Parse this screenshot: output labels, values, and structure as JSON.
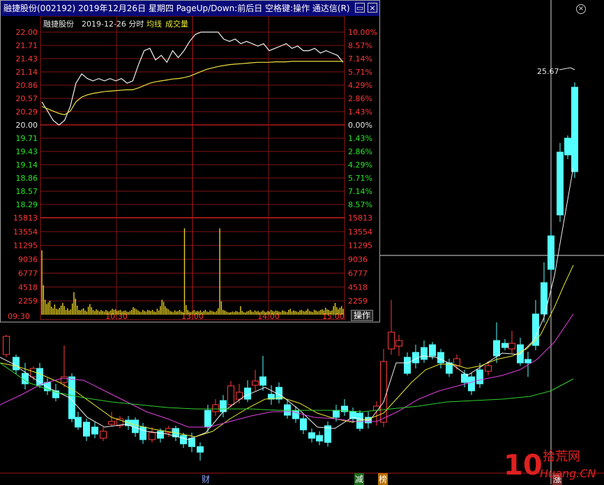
{
  "window": {
    "title": "融捷股份(002192)  2019年12月26日  星期四  PageUp/Down:前后日  空格键:操作  通达信(R)",
    "restore_label": "▭",
    "close_label": "×"
  },
  "intraday": {
    "header_name": "融捷股份",
    "header_date": "2019-12-26 分时",
    "header_avg": "均线",
    "header_vol": "成交量",
    "price_ticks": [
      "22.00",
      "21.71",
      "21.43",
      "21.14",
      "20.86",
      "20.57",
      "20.29",
      "20.00",
      "19.71",
      "19.43",
      "19.14",
      "18.86",
      "18.57",
      "18.29"
    ],
    "pct_ticks": [
      "10.00%",
      "8.57%",
      "7.14%",
      "5.71%",
      "4.29%",
      "2.86%",
      "1.43%",
      "0.00%",
      "1.43%",
      "2.86%",
      "4.29%",
      "5.71%",
      "7.14%",
      "8.57%"
    ],
    "vol_ticks": [
      "15813",
      "13554",
      "11295",
      "9036",
      "6777",
      "4518",
      "2259"
    ],
    "time_ticks": [
      "09:30",
      "10:30",
      "13:00",
      "14:00",
      "15:00"
    ],
    "operate_label": "操作"
  },
  "chart_data": [
    {
      "type": "line",
      "title": "2019-12-26 分时",
      "xlabel": "",
      "ylabel": "",
      "x_ticks": [
        "09:30",
        "10:30",
        "13:00",
        "14:00",
        "15:00"
      ],
      "ylim": [
        18.0,
        22.0
      ],
      "prev_close": 20.0,
      "series": [
        {
          "name": "",
          "values": [
            20.5,
            20.3,
            20.1,
            20.0,
            20.1,
            20.4,
            20.9,
            21.1,
            21.0,
            20.95,
            21.0,
            20.95,
            21.0,
            20.95,
            21.0,
            20.9,
            20.95,
            21.3,
            21.6,
            21.65,
            21.4,
            21.5,
            21.35,
            21.6,
            21.45,
            21.6,
            21.8,
            21.95,
            22.0,
            22.0,
            22.0,
            22.0,
            21.85,
            21.8,
            21.85,
            21.75,
            21.8,
            21.75,
            21.7,
            21.75,
            21.6,
            21.65,
            21.7,
            21.75,
            21.65,
            21.7,
            21.6,
            21.6,
            21.65,
            21.55,
            21.6,
            21.55,
            21.5,
            21.35
          ]
        },
        {
          "name": "均线",
          "values": [
            20.4,
            20.35,
            20.3,
            20.25,
            20.22,
            20.3,
            20.5,
            20.6,
            20.65,
            20.68,
            20.7,
            20.72,
            20.73,
            20.74,
            20.75,
            20.76,
            20.76,
            20.8,
            20.85,
            20.9,
            20.93,
            20.95,
            20.97,
            20.99,
            21.0,
            21.02,
            21.05,
            21.1,
            21.15,
            21.2,
            21.23,
            21.26,
            21.28,
            21.3,
            21.31,
            21.32,
            21.33,
            21.34,
            21.35,
            21.35,
            21.35,
            21.36,
            21.36,
            21.36,
            21.37,
            21.37,
            21.37,
            21.37,
            21.37,
            21.37,
            21.37,
            21.37,
            21.37,
            21.37
          ]
        }
      ]
    },
    {
      "type": "bar",
      "title": "成交量",
      "xlabel": "",
      "ylabel": "",
      "ylim": [
        0,
        18072
      ],
      "values": [
        12000,
        5500,
        2800,
        2000,
        2300,
        2600,
        1500,
        1200,
        1900,
        1100,
        1000,
        1300,
        1700,
        2200,
        1600,
        900,
        1200,
        800,
        1000,
        2100,
        4200,
        3000,
        1700,
        900,
        800,
        1000,
        1200,
        800,
        600,
        1500,
        2000,
        1400,
        900,
        700,
        1000,
        800,
        600,
        900,
        700,
        600,
        900,
        700,
        600,
        800,
        1100,
        900,
        1000,
        700,
        800,
        900,
        600,
        700,
        800,
        600,
        500,
        700,
        900,
        1400,
        1200,
        1000,
        800,
        600,
        500,
        900,
        700,
        600,
        900,
        800,
        700,
        900,
        600,
        500,
        1100,
        800,
        1600,
        2800,
        2400,
        1600,
        1200,
        1000,
        700,
        600,
        500,
        800,
        600,
        700,
        900,
        600,
        500,
        16100,
        1800,
        900,
        600,
        500,
        700,
        900,
        600,
        700,
        600,
        800,
        500,
        700,
        900,
        600,
        500,
        800,
        700,
        600,
        500,
        700,
        1200,
        16100,
        2500,
        900,
        800,
        600,
        500,
        400,
        500,
        600,
        500,
        700,
        600,
        500,
        1600,
        700,
        500,
        400,
        600,
        700,
        900,
        600,
        500,
        800,
        600,
        700,
        500,
        600,
        800,
        600,
        500,
        700,
        600,
        900,
        700,
        600,
        800,
        700,
        600,
        500,
        800,
        700,
        600,
        500,
        900,
        1100,
        600,
        800,
        700,
        600,
        500,
        800,
        900,
        700,
        600,
        800,
        1100,
        700,
        600,
        500,
        900,
        800,
        600,
        700,
        900,
        1000,
        800,
        1300,
        1000,
        900,
        700,
        800,
        1600,
        2200,
        1400,
        1000,
        1300,
        1600,
        1100
      ]
    }
  ],
  "main_chart": {
    "price_label": "25.67",
    "markers": [
      "财",
      "减",
      "榜",
      "涨"
    ],
    "watermark": "10 拾荒网 Huang.CN"
  }
}
